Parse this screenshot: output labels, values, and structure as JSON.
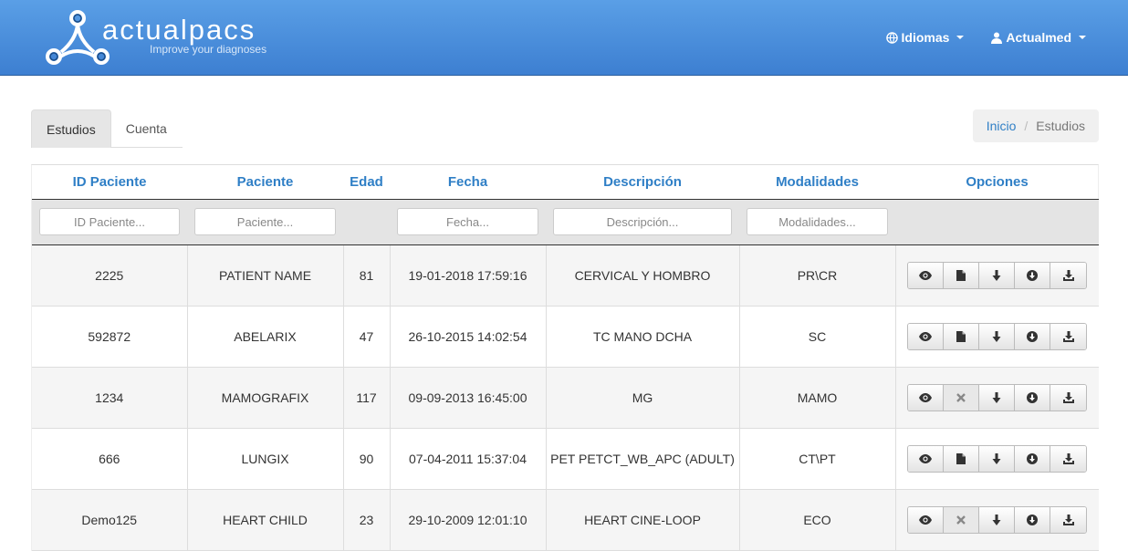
{
  "header": {
    "logo_name": "actualpacs",
    "logo_tagline": "Improve your diagnoses",
    "nav": [
      {
        "label": "Idiomas",
        "icon": "globe-icon"
      },
      {
        "label": "Actualmed",
        "icon": "user-icon"
      }
    ]
  },
  "tabs": [
    {
      "label": "Estudios",
      "active": true
    },
    {
      "label": "Cuenta",
      "active": false
    }
  ],
  "breadcrumb": {
    "home": "Inicio",
    "separator": "/",
    "current": "Estudios"
  },
  "table": {
    "columns": [
      "ID Paciente",
      "Paciente",
      "Edad",
      "Fecha",
      "Descripción",
      "Modalidades",
      "Opciones"
    ],
    "filters": {
      "id": "ID Paciente...",
      "patient": "Paciente...",
      "date": "Fecha...",
      "description": "Descripción...",
      "modalities": "Modalidades..."
    },
    "rows": [
      {
        "id": "2225",
        "patient": "PATIENT NAME",
        "age": "81",
        "date": "19-01-2018 17:59:16",
        "description": "CERVICAL Y HOMBRO",
        "modalities": "PR\\CR",
        "report_icon": "file-icon"
      },
      {
        "id": "592872",
        "patient": "ABELARIX",
        "age": "47",
        "date": "26-10-2015 14:02:54",
        "description": "TC MANO DCHA",
        "modalities": "SC",
        "report_icon": "file-icon"
      },
      {
        "id": "1234",
        "patient": "MAMOGRAFIX",
        "age": "117",
        "date": "09-09-2013 16:45:00",
        "description": "MG",
        "modalities": "MAMO",
        "report_icon": "x-icon"
      },
      {
        "id": "666",
        "patient": "LUNGIX",
        "age": "90",
        "date": "07-04-2011 15:37:04",
        "description": "PET PETCT_WB_APC (ADULT)",
        "modalities": "CT\\PT",
        "report_icon": "file-icon"
      },
      {
        "id": "Demo125",
        "patient": "HEART CHILD",
        "age": "23",
        "date": "29-10-2009 12:01:10",
        "description": "HEART CINE-LOOP",
        "modalities": "ECO",
        "report_icon": "x-icon"
      }
    ]
  }
}
